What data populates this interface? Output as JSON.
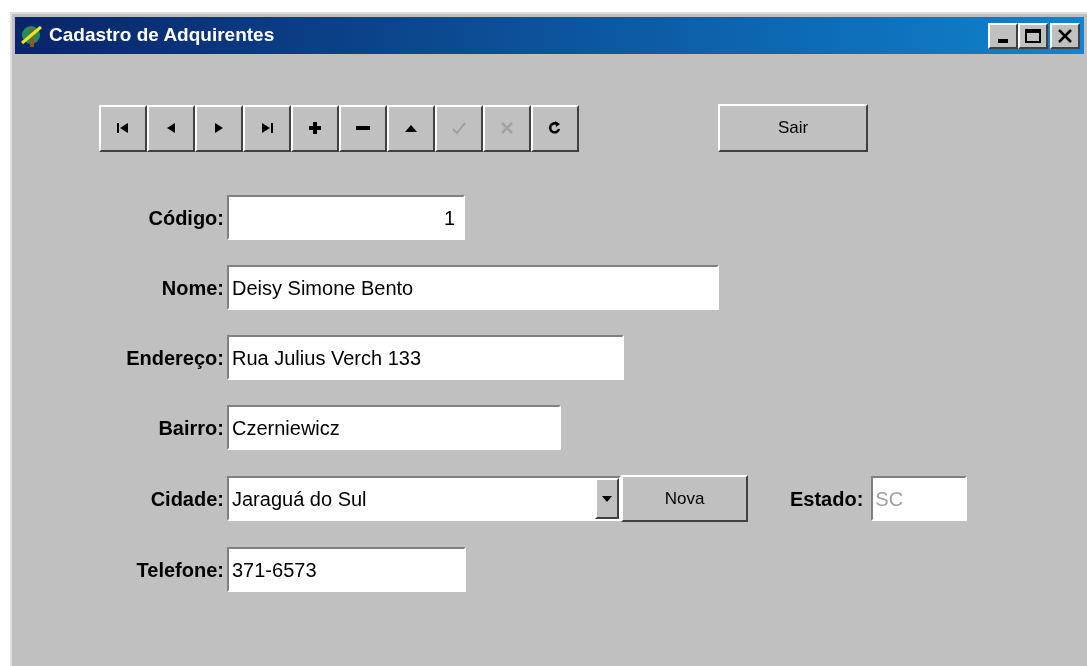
{
  "window": {
    "title": "Cadastro de Adquirentes"
  },
  "navigator": {
    "buttons": [
      {
        "kind": "first",
        "disabled": false
      },
      {
        "kind": "prior",
        "disabled": false
      },
      {
        "kind": "next",
        "disabled": false
      },
      {
        "kind": "last",
        "disabled": false
      },
      {
        "kind": "insert",
        "disabled": false
      },
      {
        "kind": "delete",
        "disabled": false
      },
      {
        "kind": "edit",
        "disabled": false
      },
      {
        "kind": "post",
        "disabled": true
      },
      {
        "kind": "cancel",
        "disabled": true
      },
      {
        "kind": "refresh",
        "disabled": false
      }
    ]
  },
  "exit_button": "Sair",
  "fields": [
    {
      "label": "Código:",
      "value": "1",
      "kind": "number"
    },
    {
      "label": "Nome:",
      "value": "Deisy Simone Bento",
      "kind": "text"
    },
    {
      "label": "Endereço:",
      "value": "Rua Julius Verch 133",
      "kind": "text"
    },
    {
      "label": "Bairro:",
      "value": "Czerniewicz",
      "kind": "text"
    },
    {
      "label": "Cidade:",
      "value": "Jaraguá do Sul",
      "kind": "combo",
      "button": "Nova",
      "extra_label": "Estado:",
      "extra_value": "SC",
      "extra_disabled": true
    },
    {
      "label": "Telefone:",
      "value": "371-6573",
      "kind": "text"
    }
  ]
}
